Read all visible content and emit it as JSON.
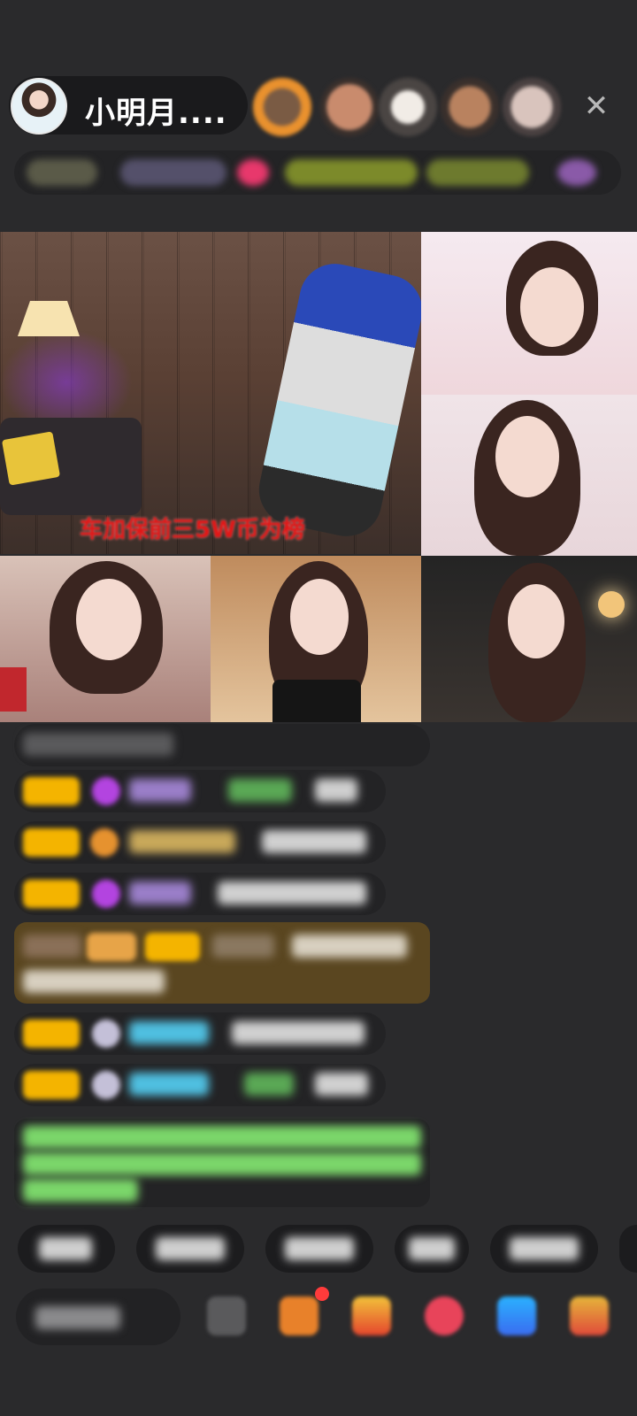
{
  "header": {
    "host_name": "小明月....",
    "viewers": [
      {
        "name": "viewer-1",
        "color": "#e9912e"
      },
      {
        "name": "viewer-2",
        "color": "#c98b6d"
      },
      {
        "name": "viewer-3",
        "color": "#d9d2cb"
      },
      {
        "name": "viewer-4",
        "color": "#b9825f"
      },
      {
        "name": "viewer-5",
        "color": "#c9b3ad"
      }
    ],
    "close_symbol": "✕"
  },
  "stream": {
    "main_caption": "车加保前三5W币为榜"
  },
  "colors": {
    "background": "#2a2a2c",
    "pill": "#1a1a1c",
    "announce": "#5a4620",
    "badge_yellow": "#f4b400",
    "purple": "#b344e0",
    "green_text": "#7bd66a",
    "cyan_text": "#4fbfe0"
  }
}
